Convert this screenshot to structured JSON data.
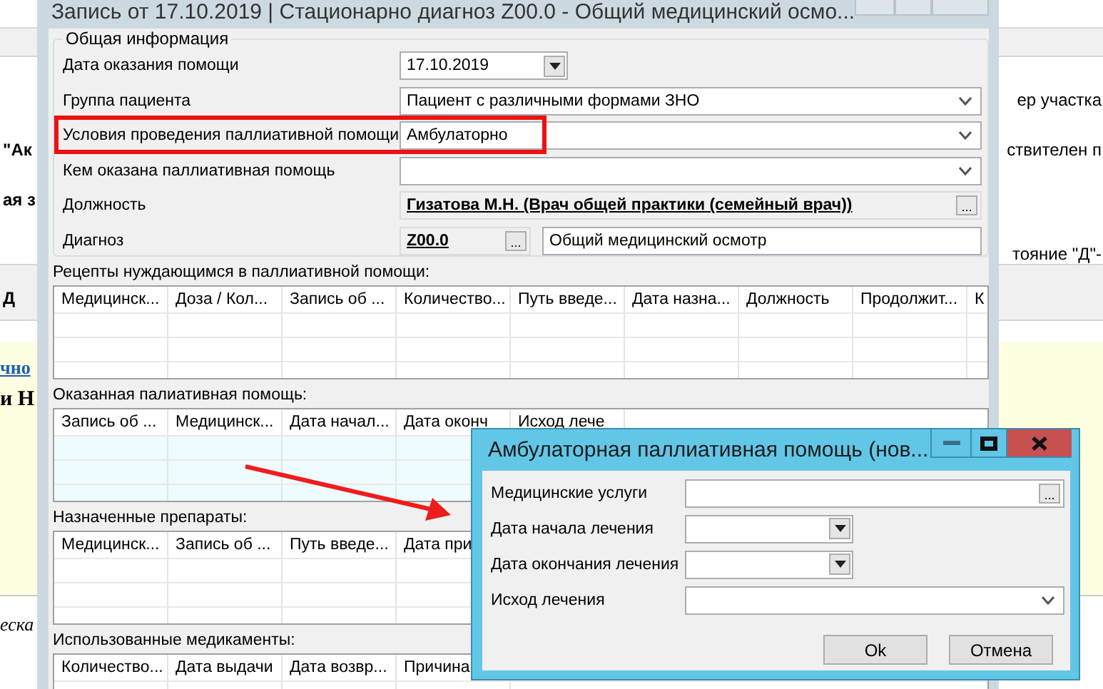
{
  "background_page": {
    "bands": [
      {
        "kind": "plain"
      },
      {
        "kind": "bar"
      },
      {
        "kind": "plain",
        "lines": [
          {
            "right": {
              "text": "ер участка",
              "kind": "text"
            }
          },
          {
            "left": {
              "text": "\"Ак",
              "kind": "bold"
            },
            "right": {
              "text": "ствителен п",
              "kind": "text"
            }
          },
          {
            "left": {
              "text": "ая з",
              "kind": "bold"
            }
          },
          {
            "right": {
              "text": "тояние \"Д\"-",
              "kind": "text"
            }
          }
        ]
      },
      {
        "kind": "bar",
        "lines": [
          {
            "left": {
              "text": "Д",
              "kind": "bold"
            }
          }
        ]
      },
      {
        "kind": "plain"
      },
      {
        "kind": "note",
        "lines": [
          {
            "left": {
              "text": "чно",
              "kind": "link"
            }
          },
          {
            "left": {
              "text": "и Н",
              "kind": "heading"
            }
          }
        ]
      },
      {
        "kind": "plain",
        "lines": [
          {
            "left": {
              "text": "еска",
              "kind": "italic"
            }
          }
        ]
      }
    ]
  },
  "main_window": {
    "title": "Запись от 17.10.2019 | Стационарно диагноз Z00.0 - Общий медицинский осмо...",
    "general_info": {
      "title": "Общая информация",
      "fields": [
        {
          "label": "Дата оказания помощи",
          "kind": "date",
          "value": "17.10.2019",
          "highlighted": false
        },
        {
          "label": "Группа пациента",
          "kind": "combo",
          "value": "Пациент с различными формами ЗНО",
          "highlighted": false
        },
        {
          "label": "Условия проведения паллиативной помощи",
          "kind": "combo",
          "value": "Амбулаторно",
          "highlighted": true
        },
        {
          "label": "Кем оказана паллиативная помощь",
          "kind": "combo",
          "highlighted": false
        },
        {
          "label": "Должность",
          "kind": "lookup",
          "value": "Гизатова М.Н. (Врач общей практики (семейный врач))",
          "picker": "...",
          "highlighted": false
        },
        {
          "label": "Диагноз",
          "kind": "code",
          "value": "Z00.0",
          "picker": "...",
          "description": "Общий медицинский осмотр",
          "highlighted": false
        }
      ]
    },
    "tables": [
      {
        "title": "Рецепты нуждающимся в паллиативной помощи:",
        "focused": false,
        "columns": [
          "Медицинск...",
          "Доза / Кол...",
          "Запись об ...",
          "Количество...",
          "Путь введе...",
          "Дата назна...",
          "Должность",
          "Продолжит...",
          "К"
        ]
      },
      {
        "title": "Оказанная палиативная помощь:",
        "focused": true,
        "columns": [
          "Запись об ...",
          "Медицинск...",
          "Дата начал...",
          "Дата оконч",
          "Исход лече"
        ]
      },
      {
        "title": "Назначенные препараты:",
        "focused": false,
        "columns": [
          "Медицинск...",
          "Запись об ...",
          "Путь введе...",
          "Дата при"
        ]
      },
      {
        "title": "Использованные медикаменты:",
        "focused": false,
        "columns": [
          "Количество...",
          "Дата выдачи",
          "Дата возвр...",
          "Причина"
        ]
      }
    ]
  },
  "annotation_arrow": true,
  "dialog": {
    "title": "Амбулаторная паллиативная помощь (нов...",
    "fields": [
      {
        "label": "Медицинские услуги",
        "kind": "lookup",
        "picker": "..."
      },
      {
        "label": "Дата начала лечения",
        "kind": "date"
      },
      {
        "label": "Дата окончания лечения",
        "kind": "date"
      },
      {
        "label": "Исход лечения",
        "kind": "combo"
      }
    ],
    "buttons": [
      "Ok",
      "Отмена"
    ]
  }
}
